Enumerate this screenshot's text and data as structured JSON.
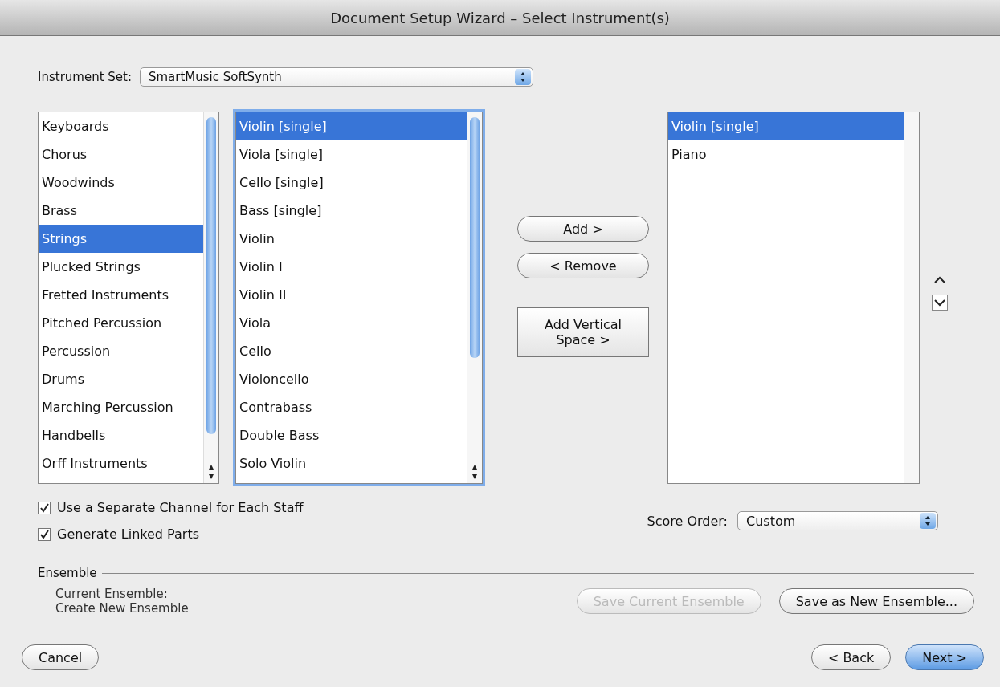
{
  "window": {
    "title": "Document Setup Wizard – Select Instrument(s)"
  },
  "instrument_set": {
    "label": "Instrument Set:",
    "value": "SmartMusic SoftSynth"
  },
  "categories": [
    {
      "label": "Keyboards",
      "selected": false
    },
    {
      "label": "Chorus",
      "selected": false
    },
    {
      "label": "Woodwinds",
      "selected": false
    },
    {
      "label": "Brass",
      "selected": false
    },
    {
      "label": "Strings",
      "selected": true
    },
    {
      "label": "Plucked Strings",
      "selected": false
    },
    {
      "label": "Fretted Instruments",
      "selected": false
    },
    {
      "label": "Pitched Percussion",
      "selected": false
    },
    {
      "label": "Percussion",
      "selected": false
    },
    {
      "label": "Drums",
      "selected": false
    },
    {
      "label": "Marching Percussion",
      "selected": false
    },
    {
      "label": "Handbells",
      "selected": false
    },
    {
      "label": "Orff Instruments",
      "selected": false
    }
  ],
  "instruments": [
    {
      "label": "Violin [single]",
      "selected": true
    },
    {
      "label": "Viola [single]",
      "selected": false
    },
    {
      "label": "Cello [single]",
      "selected": false
    },
    {
      "label": "Bass [single]",
      "selected": false
    },
    {
      "label": "Violin",
      "selected": false
    },
    {
      "label": "Violin I",
      "selected": false
    },
    {
      "label": "Violin II",
      "selected": false
    },
    {
      "label": "Viola",
      "selected": false
    },
    {
      "label": "Cello",
      "selected": false
    },
    {
      "label": "Violoncello",
      "selected": false
    },
    {
      "label": "Contrabass",
      "selected": false
    },
    {
      "label": "Double Bass",
      "selected": false
    },
    {
      "label": "Solo Violin",
      "selected": false
    }
  ],
  "transfer_buttons": [
    {
      "label": "Add >",
      "kind": "rounded"
    },
    {
      "label": "< Remove",
      "kind": "rounded"
    },
    {
      "label": "Add Vertical Space >",
      "kind": "square"
    }
  ],
  "score": [
    {
      "label": "Violin [single]",
      "selected": true
    },
    {
      "label": "Piano",
      "selected": false
    }
  ],
  "options": [
    {
      "label": "Use a Separate Channel for Each Staff",
      "checked": true
    },
    {
      "label": "Generate Linked Parts",
      "checked": true
    }
  ],
  "score_order": {
    "label": "Score Order:",
    "value": "Custom"
  },
  "ensemble": {
    "heading": "Ensemble",
    "current_label": "Current Ensemble:",
    "current_value": "Create New Ensemble",
    "buttons": [
      {
        "label": "Save Current Ensemble",
        "disabled": true
      },
      {
        "label": "Save as New Ensemble...",
        "disabled": false
      }
    ]
  },
  "footer": {
    "cancel": "Cancel",
    "buttons": [
      {
        "label": "< Back",
        "default": false
      },
      {
        "label": "Next >",
        "default": true
      }
    ]
  }
}
